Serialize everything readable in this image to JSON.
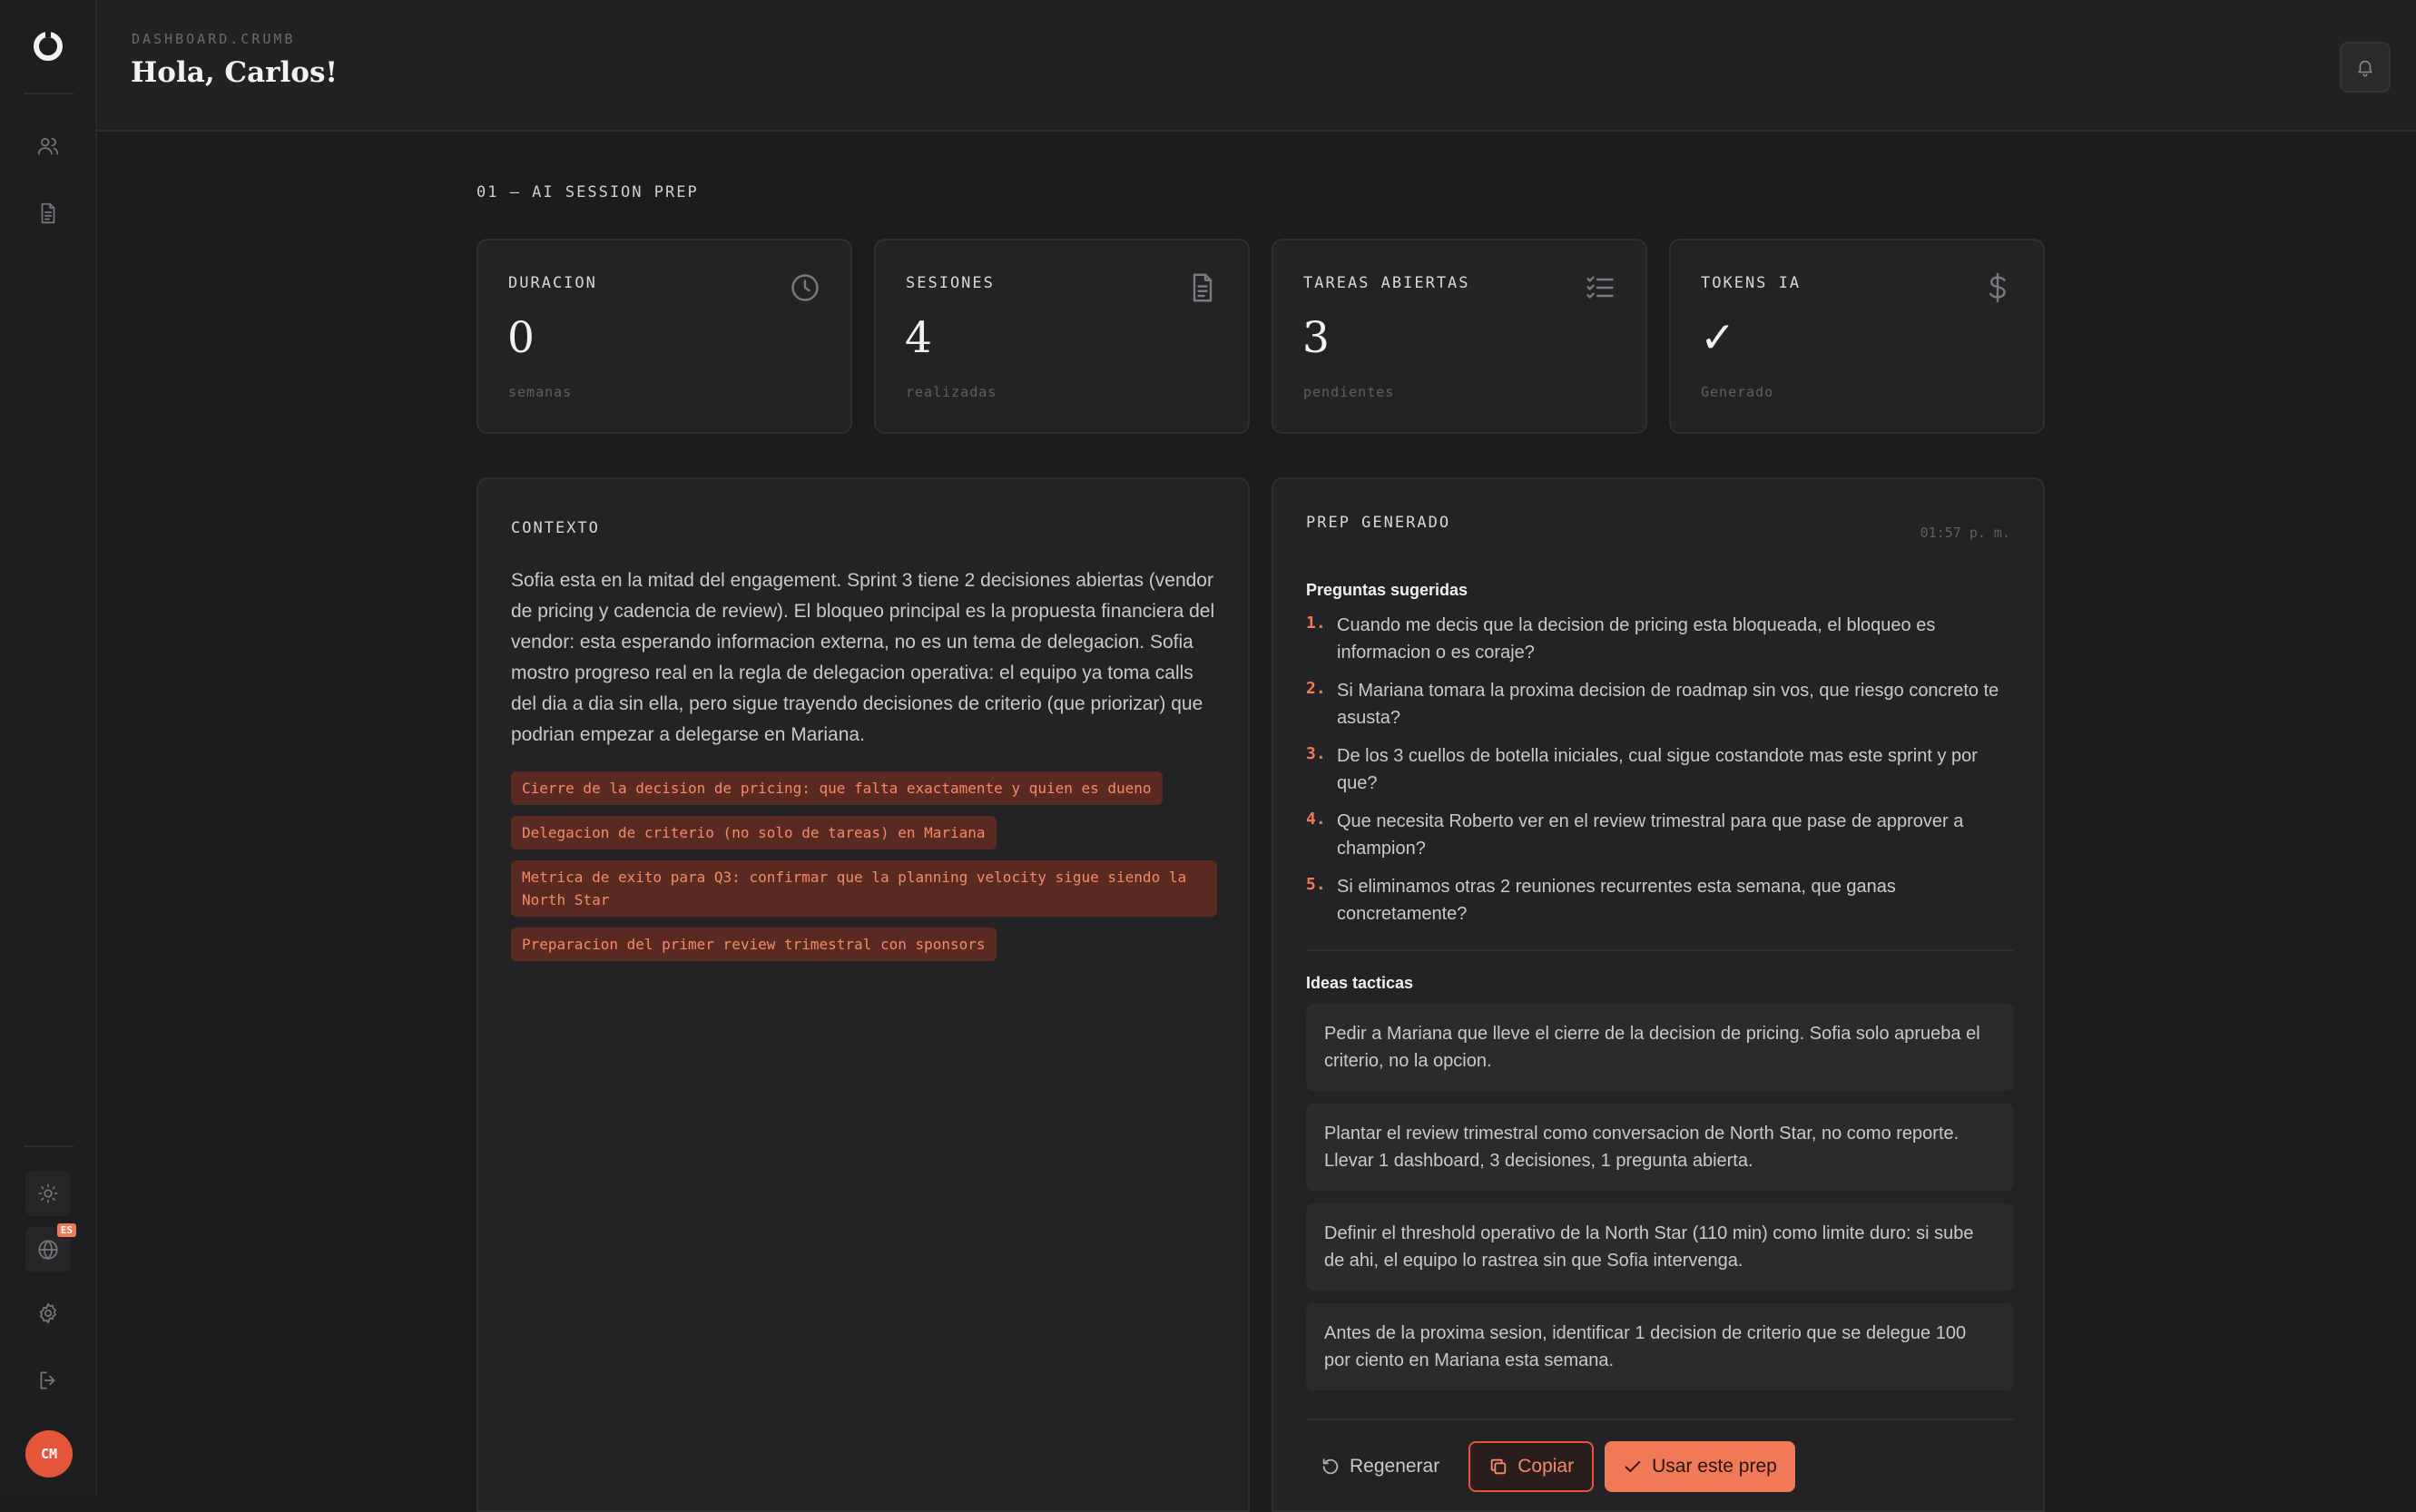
{
  "header": {
    "crumb": "DASHBOARD.CRUMB",
    "greeting": "Hola, Carlos!"
  },
  "sidebar": {
    "language_badge": "ES",
    "avatar_initials": "CM"
  },
  "main": {
    "section_title": "01 — AI SESSION PREP",
    "stats": [
      {
        "label": "DURACION",
        "value": "0",
        "sub": "semanas",
        "icon": "clock-icon"
      },
      {
        "label": "SESIONES",
        "value": "4",
        "sub": "realizadas",
        "icon": "document-icon"
      },
      {
        "label": "TAREAS ABIERTAS",
        "value": "3",
        "sub": "pendientes",
        "icon": "checklist-icon"
      },
      {
        "label": "TOKENS IA",
        "value": "✓",
        "sub": "Generado",
        "icon": "dollar-icon"
      }
    ],
    "context": {
      "label": "CONTEXTO",
      "text": "Sofia esta en la mitad del engagement. Sprint 3 tiene 2 decisiones abiertas (vendor de pricing y cadencia de review). El bloqueo principal es la propuesta financiera del vendor: esta esperando informacion externa, no es un tema de delegacion. Sofia mostro progreso real en la regla de delegacion operativa: el equipo ya toma calls del dia a dia sin ella, pero sigue trayendo decisiones de criterio (que priorizar) que podrian empezar a delegarse en Mariana.",
      "chips": [
        "Cierre de la decision de pricing: que falta exactamente y quien es dueno",
        "Delegacion de criterio (no solo de tareas) en Mariana",
        "Metrica de exito para Q3: confirmar que la planning velocity sigue siendo la North Star",
        "Preparacion del primer review trimestral con sponsors"
      ]
    },
    "prep": {
      "label": "PREP GENERADO",
      "timestamp": "01:57 p. m.",
      "questions_title": "Preguntas sugeridas",
      "questions": [
        {
          "num": "1.",
          "text": "Cuando me decis que la decision de pricing esta bloqueada, el bloqueo es informacion o es coraje?"
        },
        {
          "num": "2.",
          "text": "Si Mariana tomara la proxima decision de roadmap sin vos, que riesgo concreto te asusta?"
        },
        {
          "num": "3.",
          "text": "De los 3 cuellos de botella iniciales, cual sigue costandote mas este sprint y por que?"
        },
        {
          "num": "4.",
          "text": "Que necesita Roberto ver en el review trimestral para que pase de approver a champion?"
        },
        {
          "num": "5.",
          "text": "Si eliminamos otras 2 reuniones recurrentes esta semana, que ganas concretamente?"
        }
      ],
      "ideas_title": "Ideas tacticas",
      "ideas": [
        "Pedir a Mariana que lleve el cierre de la decision de pricing. Sofia solo aprueba el criterio, no la opcion.",
        "Plantar el review trimestral como conversacion de North Star, no como reporte. Llevar 1 dashboard, 3 decisiones, 1 pregunta abierta.",
        "Definir el threshold operativo de la North Star (110 min) como limite duro: si sube de ahi, el equipo lo rastrea sin que Sofia intervenga.",
        "Antes de la proxima sesion, identificar 1 decision de criterio que se delegue 100 por ciento en Mariana esta semana."
      ],
      "actions": {
        "regenerate": "Regenerar",
        "copy": "Copiar",
        "use": "Usar este prep"
      }
    }
  },
  "colors": {
    "background": "#1c1c1e",
    "panel": "#232325",
    "accent": "#f07a58",
    "chip_bg": "#5a2a22",
    "chip_text": "#f58a6a"
  }
}
